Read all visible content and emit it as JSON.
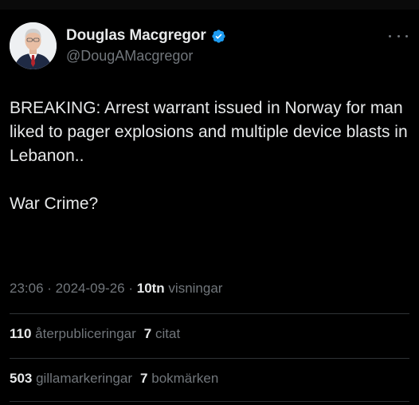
{
  "author": {
    "display_name": "Douglas Macgregor",
    "handle": "@DougAMacgregor",
    "verified": true,
    "avatar_icon": "profile-photo",
    "verified_icon": "verified-badge-icon",
    "verified_color": "#1d9bf0"
  },
  "tweet": {
    "text": "BREAKING: Arrest warrant issued in Norway for man liked to pager explosions and multiple device blasts in Lebanon..\n\nWar Crime?"
  },
  "meta": {
    "time": "23:06",
    "sep1": " · ",
    "date": "2024-09-26",
    "sep2": " · ",
    "views_count": "10tn",
    "views_label": " visningar"
  },
  "stats": {
    "reposts_count": "110",
    "reposts_label": " återpubliceringar",
    "quotes_count": "7",
    "quotes_label": " citat",
    "likes_count": "503",
    "likes_label": " gillamarkeringar",
    "bookmarks_count": "7",
    "bookmarks_label": " bokmärken"
  },
  "colors": {
    "background": "#000000",
    "text_primary": "#e7e9ea",
    "text_secondary": "#71767b",
    "divider": "#2f3336"
  }
}
